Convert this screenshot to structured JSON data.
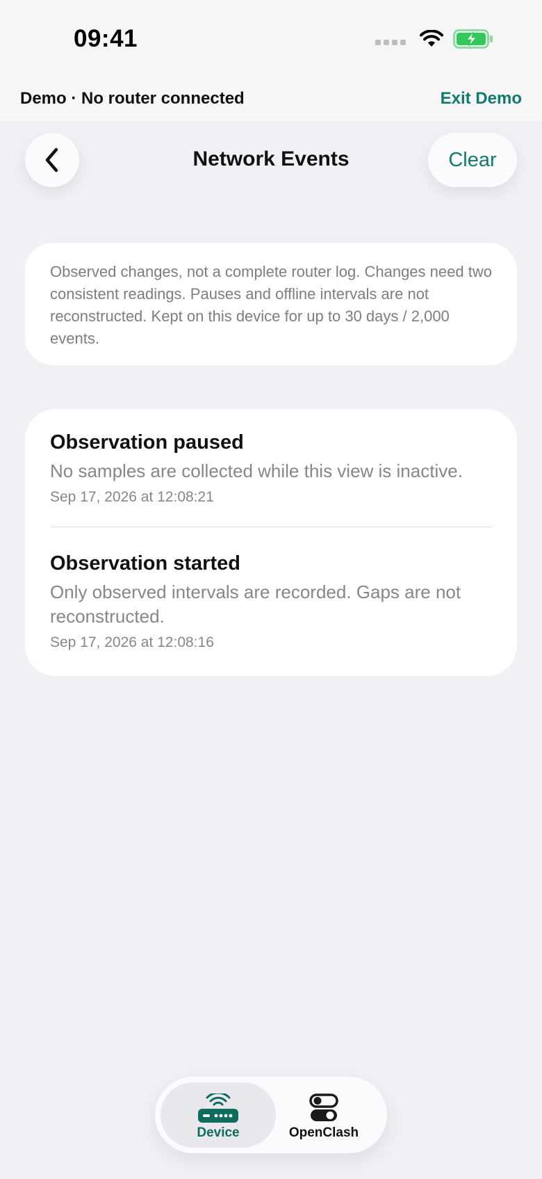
{
  "status_bar": {
    "time": "09:41",
    "icons": [
      "cellular-signal-icon",
      "wifi-icon",
      "battery-charging-icon"
    ]
  },
  "demo_banner": {
    "text": "Demo · No router connected",
    "exit_label": "Exit Demo"
  },
  "header": {
    "back_icon": "chevron-left-icon",
    "title": "Network Events",
    "clear_label": "Clear"
  },
  "info": {
    "text": "Observed changes, not a complete router log. Changes need two consistent readings. Pauses and offline intervals are not reconstructed. Kept on this device for up to 30 days / 2,000 events."
  },
  "events": [
    {
      "title": "Observation paused",
      "description": "No samples are collected while this view is inactive.",
      "timestamp": "Sep 17, 2026 at 12:08:21"
    },
    {
      "title": "Observation started",
      "description": "Only observed intervals are recorded. Gaps are not reconstructed.",
      "timestamp": "Sep 17, 2026 at 12:08:16"
    }
  ],
  "tabs": [
    {
      "label": "Device",
      "icon": "router-icon",
      "selected": true
    },
    {
      "label": "OpenClash",
      "icon": "toggles-icon",
      "selected": false
    }
  ],
  "colors": {
    "accent": "#0f7a6e",
    "background": "#f1f0f5",
    "card": "#ffffff",
    "secondary_text": "#86868b",
    "battery_green": "#34c759"
  }
}
